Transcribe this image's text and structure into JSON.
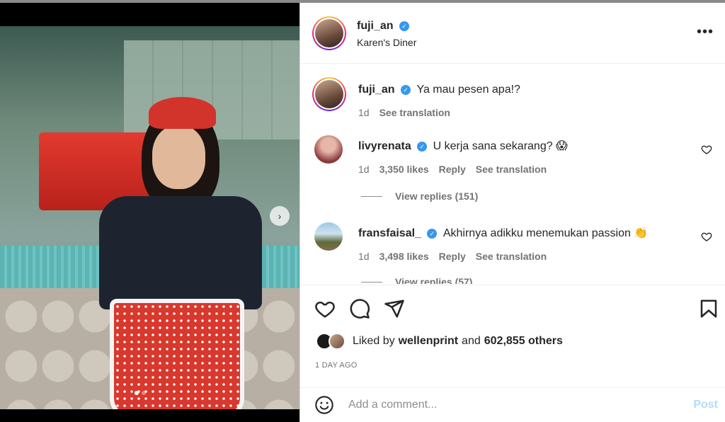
{
  "post": {
    "author": "fuji_an",
    "location": "Karen's Diner",
    "caption": "Ya mau pesen apa!?",
    "caption_time": "1d",
    "caption_translate": "See translation",
    "more_icon": "more-horizontal-icon",
    "verified_icon": "verified-badge-icon"
  },
  "comments": [
    {
      "username": "livyrenata",
      "text": "U kerja sana sekarang? 😱",
      "time": "1d",
      "likes": "3,350 likes",
      "reply": "Reply",
      "translate": "See translation",
      "replies": "View replies (151)"
    },
    {
      "username": "fransfaisal_",
      "text": "Akhirnya adikku menemukan passion 👏",
      "time": "1d",
      "likes": "3,498 likes",
      "reply": "Reply",
      "translate": "See translation",
      "replies": "View replies (57)"
    }
  ],
  "actions": {
    "icons": [
      "heart-icon",
      "comment-icon",
      "share-icon",
      "bookmark-icon"
    ],
    "liked_by_prefix": "Liked by",
    "liked_by_user": "wellenprint",
    "liked_by_and": "and",
    "liked_by_others": "602,855 others",
    "timestamp": "1 DAY AGO"
  },
  "comment_box": {
    "placeholder": "Add a comment...",
    "post_label": "Post"
  },
  "carousel": {
    "next_icon": "chevron-right-icon"
  },
  "colors": {
    "verified": "#3897f0",
    "post_disabled": "#b3dbff",
    "muted": "#737373"
  }
}
